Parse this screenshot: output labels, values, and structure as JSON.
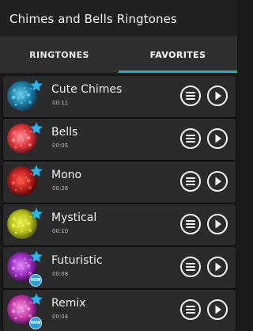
{
  "appbar": {
    "title": "Chimes and Bells Ringtones"
  },
  "tabs": [
    {
      "label": "RINGTONES",
      "selected": false
    },
    {
      "label": "FAVORITES",
      "selected": true
    }
  ],
  "colors": {
    "accent": "#1eb4cc",
    "star": "#2bb5e8"
  },
  "ringtones": [
    {
      "name": "Cute Chimes",
      "duration": "00:11",
      "favorite": true,
      "new_badge": "",
      "thumb_colors": [
        "#1e7fa6",
        "#0b3552",
        "#6fd0ef"
      ]
    },
    {
      "name": "Bells",
      "duration": "00:05",
      "favorite": true,
      "new_badge": "",
      "thumb_colors": [
        "#e0383c",
        "#5a0b10",
        "#ff9aa0"
      ]
    },
    {
      "name": "Mono",
      "duration": "00:26",
      "favorite": true,
      "new_badge": "",
      "thumb_colors": [
        "#b8201e",
        "#3a0506",
        "#ff5a4a"
      ]
    },
    {
      "name": "Mystical",
      "duration": "00:10",
      "favorite": true,
      "new_badge": "",
      "thumb_colors": [
        "#b7c21a",
        "#4b5205",
        "#eef35a"
      ]
    },
    {
      "name": "Futuristic",
      "duration": "00:08",
      "favorite": true,
      "new_badge": "NEW",
      "thumb_colors": [
        "#9b2fc0",
        "#2e0a3f",
        "#e08af7"
      ]
    },
    {
      "name": "Remix",
      "duration": "00:04",
      "favorite": true,
      "new_badge": "NEW",
      "thumb_colors": [
        "#c43aa8",
        "#3a0a4a",
        "#f3a0e6"
      ]
    }
  ]
}
